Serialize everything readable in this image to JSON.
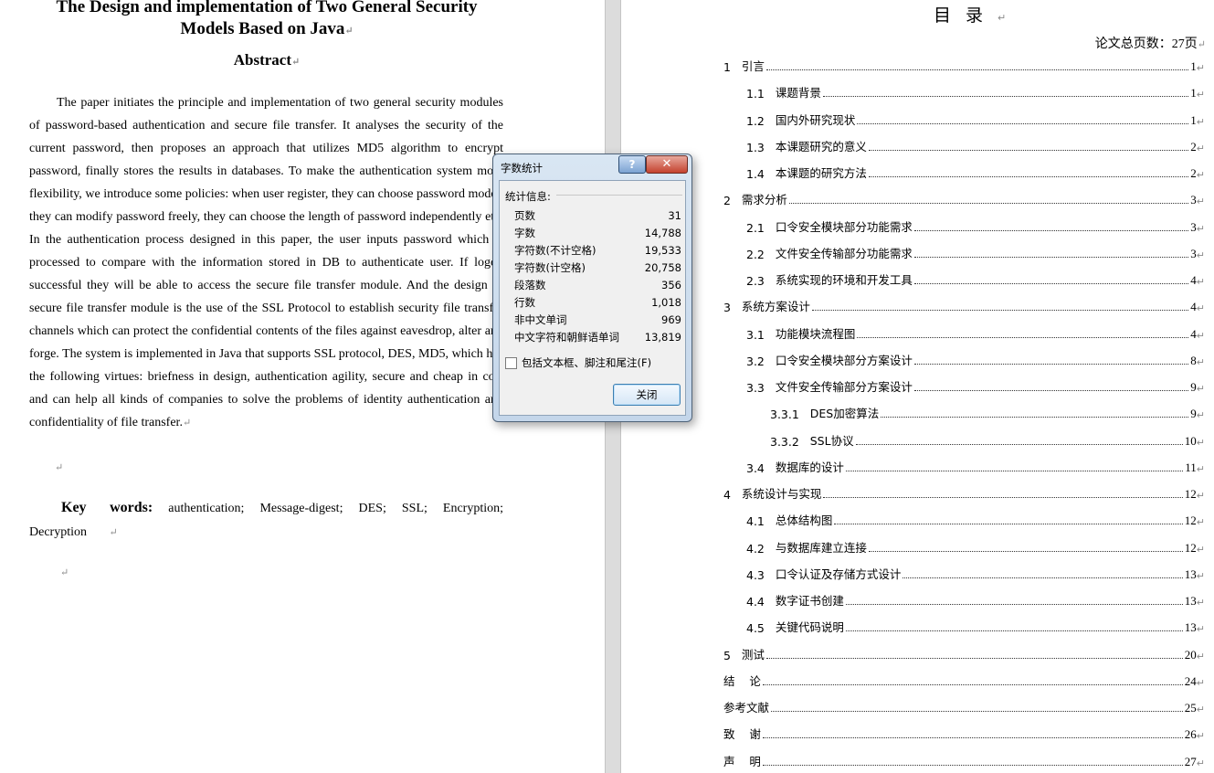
{
  "left_page": {
    "title": "The Design and implementation of Two General Security Models Based on Java",
    "abstract_heading": "Abstract",
    "abstract_body": "The paper initiates the principle and implementation of two general security modules of password-based authentication and secure file transfer. It analyses the security of the current password, then proposes an approach that utilizes MD5 algorithm to encrypt password, finally stores the results in databases. To make the authentication system more flexibility, we introduce some policies: when user register, they can choose password model, they can modify password freely, they can choose the length of password independently etc. In the authentication process designed in this paper, the user inputs password which is processed to compare with the information stored in DB to authenticate user. If logon successful they will be able to access the secure file transfer module. And the design of secure file transfer module is the use of the SSL Protocol to establish security file transfer channels which can protect the confidential contents of the files against eavesdrop, alter and forge. The system is implemented in Java that supports SSL protocol, DES, MD5, which has the following virtues: briefness in design, authentication agility, secure and cheap in cost and can help all kinds of companies to solve the problems of identity authentication and confidentiality of file transfer.",
    "keywords_label": "Key words:",
    "keywords_text": "authentication; Message-digest; DES; SSL; Encryption; Decryption",
    "paragraph_mark": "↵"
  },
  "right_page": {
    "toc_title": "目录",
    "page_count": "论文总页数：27页",
    "toc": [
      {
        "num": "1   ",
        "text": "引言",
        "page": "1"
      },
      {
        "num": "1.1   ",
        "text": "课题背景",
        "page": "1"
      },
      {
        "num": "1.2   ",
        "text": "国内外研究现状",
        "page": "1"
      },
      {
        "num": "1.3   ",
        "text": "本课题研究的意义",
        "page": "2"
      },
      {
        "num": "1.4   ",
        "text": "本课题的研究方法",
        "page": "2"
      },
      {
        "num": "2   ",
        "text": "需求分析",
        "page": "3"
      },
      {
        "num": "2.1   ",
        "text": "口令安全模块部分功能需求",
        "page": "3"
      },
      {
        "num": "2.2   ",
        "text": "文件安全传输部分功能需求",
        "page": "3"
      },
      {
        "num": "2.3   ",
        "text": "系统实现的环境和开发工具",
        "page": "4"
      },
      {
        "num": "3   ",
        "text": "系统方案设计",
        "page": "4"
      },
      {
        "num": "3.1   ",
        "text": "功能模块流程图",
        "page": "4"
      },
      {
        "num": "3.2   ",
        "text": "口令安全模块部分方案设计",
        "page": "8"
      },
      {
        "num": "3.3   ",
        "text": "文件安全传输部分方案设计",
        "page": "9"
      },
      {
        "num": "3.3.1   ",
        "text": "DES加密算法",
        "page": "9"
      },
      {
        "num": "3.3.2   ",
        "text": "SSL协议",
        "page": "10"
      },
      {
        "num": "3.4   ",
        "text": "数据库的设计",
        "page": "11"
      },
      {
        "num": "4   ",
        "text": "系统设计与实现",
        "page": "12"
      },
      {
        "num": "4.1   ",
        "text": "总体结构图",
        "page": "12"
      },
      {
        "num": "4.2   ",
        "text": "与数据库建立连接",
        "page": "12"
      },
      {
        "num": "4.3   ",
        "text": "口令认证及存储方式设计",
        "page": "13"
      },
      {
        "num": "4.4   ",
        "text": "数字证书创建",
        "page": "13"
      },
      {
        "num": "4.5   ",
        "text": "关键代码说明",
        "page": "13"
      },
      {
        "num": "5   ",
        "text": "测试",
        "page": "20"
      },
      {
        "num": "",
        "text": "结    论",
        "page": "24"
      },
      {
        "num": "",
        "text": "参考文献",
        "page": "25"
      },
      {
        "num": "",
        "text": "致    谢",
        "page": "26"
      },
      {
        "num": "",
        "text": "声    明",
        "page": "27"
      }
    ]
  },
  "dialog": {
    "title": "字数统计",
    "help_label": "?",
    "close_x_label": "✕",
    "section_label": "统计信息:",
    "stats": [
      {
        "label": "页数",
        "value": "31"
      },
      {
        "label": "字数",
        "value": "14,788"
      },
      {
        "label": "字符数(不计空格)",
        "value": "19,533"
      },
      {
        "label": "字符数(计空格)",
        "value": "20,758"
      },
      {
        "label": "段落数",
        "value": "356"
      },
      {
        "label": "行数",
        "value": "1,018"
      },
      {
        "label": "非中文单词",
        "value": "969"
      },
      {
        "label": "中文字符和朝鲜语单词",
        "value": "13,819"
      }
    ],
    "checkbox_label": "包括文本框、脚注和尾注(F)",
    "checkbox_checked": false,
    "close_button_label": "关闭"
  }
}
